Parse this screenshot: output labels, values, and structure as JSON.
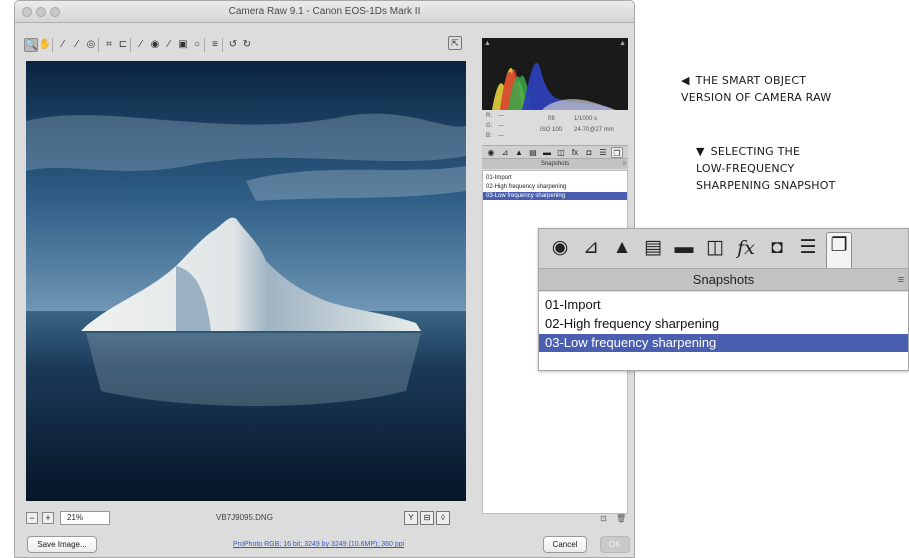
{
  "window": {
    "title": "Camera Raw 9.1  -  Canon EOS-1Ds Mark II"
  },
  "toolbar": {
    "tools": [
      {
        "name": "zoom-tool-icon",
        "glyph": "🔍"
      },
      {
        "name": "hand-tool-icon",
        "glyph": "✋"
      },
      {
        "name": "white-balance-tool-icon",
        "glyph": "⁄"
      },
      {
        "name": "color-sampler-tool-icon",
        "glyph": "⁄"
      },
      {
        "name": "targeted-adjustment-tool-icon",
        "glyph": "◎"
      },
      {
        "name": "crop-tool-icon",
        "glyph": "⌗"
      },
      {
        "name": "straighten-tool-icon",
        "glyph": "⊏"
      },
      {
        "name": "spot-removal-tool-icon",
        "glyph": "⁄"
      },
      {
        "name": "red-eye-removal-tool-icon",
        "glyph": "◉"
      },
      {
        "name": "adjustment-brush-icon",
        "glyph": "⁄"
      },
      {
        "name": "graduated-filter-icon",
        "glyph": "▣"
      },
      {
        "name": "radial-filter-icon",
        "glyph": "○"
      },
      {
        "name": "preferences-icon",
        "glyph": "≡"
      },
      {
        "name": "rotate-ccw-icon",
        "glyph": "↺"
      },
      {
        "name": "rotate-cw-icon",
        "glyph": "↻"
      }
    ],
    "fullscreen_glyph": "⇱"
  },
  "zoombar": {
    "zoom_value": "21%",
    "filename": "VB7J9095.DNG",
    "minus_glyph": "−",
    "plus_glyph": "+",
    "view_buttons": [
      "Y",
      "⊟",
      "◊"
    ]
  },
  "histogram": {
    "shadow_clip_glyph": "▲",
    "highlight_clip_glyph": "▲"
  },
  "readout": {
    "r_label": "R:",
    "r_value": "---",
    "g_label": "G:",
    "g_value": "---",
    "b_label": "B:",
    "b_value": "---",
    "aperture": "f/8",
    "shutter": "1/1000 s",
    "iso": "ISO 100",
    "lens": "24-70@27 mm"
  },
  "panel": {
    "tab_glyphs": [
      "◉",
      "⊿",
      "▲",
      "▤",
      "▬",
      "◫",
      "fx",
      "◘",
      "☰",
      "❐"
    ],
    "header": "Snapshots",
    "menu_glyph": "≡",
    "snapshots": [
      {
        "label": "01-Import",
        "selected": false
      },
      {
        "label": "02-High frequency sharpening",
        "selected": false
      },
      {
        "label": "03-Low frequency sharpening",
        "selected": true
      }
    ],
    "foot_new_glyph": "⊡",
    "foot_delete_glyph": "🗑"
  },
  "bottom": {
    "save_label": "Save Image...",
    "workflow_link": "ProPhoto RGB; 16 bit; 3249 by 3249 (10.6MP); 360 ppi",
    "cancel_label": "Cancel",
    "ok_label": "OK"
  },
  "annotations": {
    "first_glyph": "◀",
    "first_line1": "THE SMART OBJECT",
    "first_line2": "VERSION OF CAMERA RAW",
    "second_glyph": "▼",
    "second_line1": "SELECTING THE",
    "second_line2": "LOW-FREQUENCY",
    "second_line3": "SHARPENING SNAPSHOT"
  },
  "zoom_panel": {
    "tab_glyphs": [
      "◉",
      "⊿",
      "▲",
      "▤",
      "▬",
      "◫",
      "fx",
      "◘",
      "☰",
      "❐"
    ],
    "header": "Snapshots",
    "menu_glyph": "≡",
    "snapshots": [
      {
        "label": "01-Import",
        "selected": false
      },
      {
        "label": "02-High frequency sharpening",
        "selected": false
      },
      {
        "label": "03-Low frequency sharpening",
        "selected": true
      }
    ]
  },
  "colors": {
    "selection": "#4a5fb0",
    "link": "#3659c7",
    "sky_top": "#0b2a47",
    "sea": "#0c1f36"
  }
}
